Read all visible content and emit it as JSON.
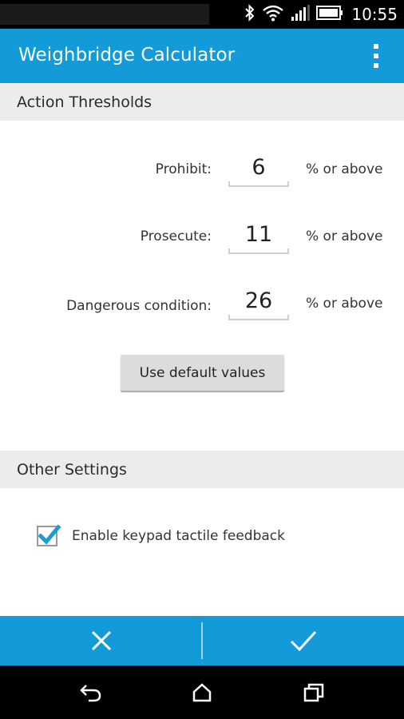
{
  "status_bar": {
    "time": "10:55",
    "icons": [
      "bluetooth-icon",
      "wifi-icon",
      "signal-icon",
      "battery-icon"
    ]
  },
  "action_bar": {
    "title": "Weighbridge Calculator",
    "overflow_icon": "more-vertical-icon"
  },
  "thresholds": {
    "header": "Action Thresholds",
    "rows": [
      {
        "label": "Prohibit:",
        "value": "6",
        "unit": "% or above"
      },
      {
        "label": "Prosecute:",
        "value": "11",
        "unit": "% or above"
      },
      {
        "label": "Dangerous condition:",
        "value": "26",
        "unit": "% or above"
      }
    ],
    "default_button": "Use default values"
  },
  "other_settings": {
    "header": "Other Settings",
    "checkbox_label": "Enable keypad tactile feedback",
    "checkbox_checked": true
  },
  "bottom_bar": {
    "cancel_icon": "close-icon",
    "confirm_icon": "checkmark-icon"
  },
  "nav_bar": {
    "icons": [
      "back-icon",
      "home-icon",
      "recent-apps-icon"
    ]
  },
  "colors": {
    "accent": "#129bd8",
    "section_bg": "#ececec",
    "check": "#1e9ad6"
  }
}
